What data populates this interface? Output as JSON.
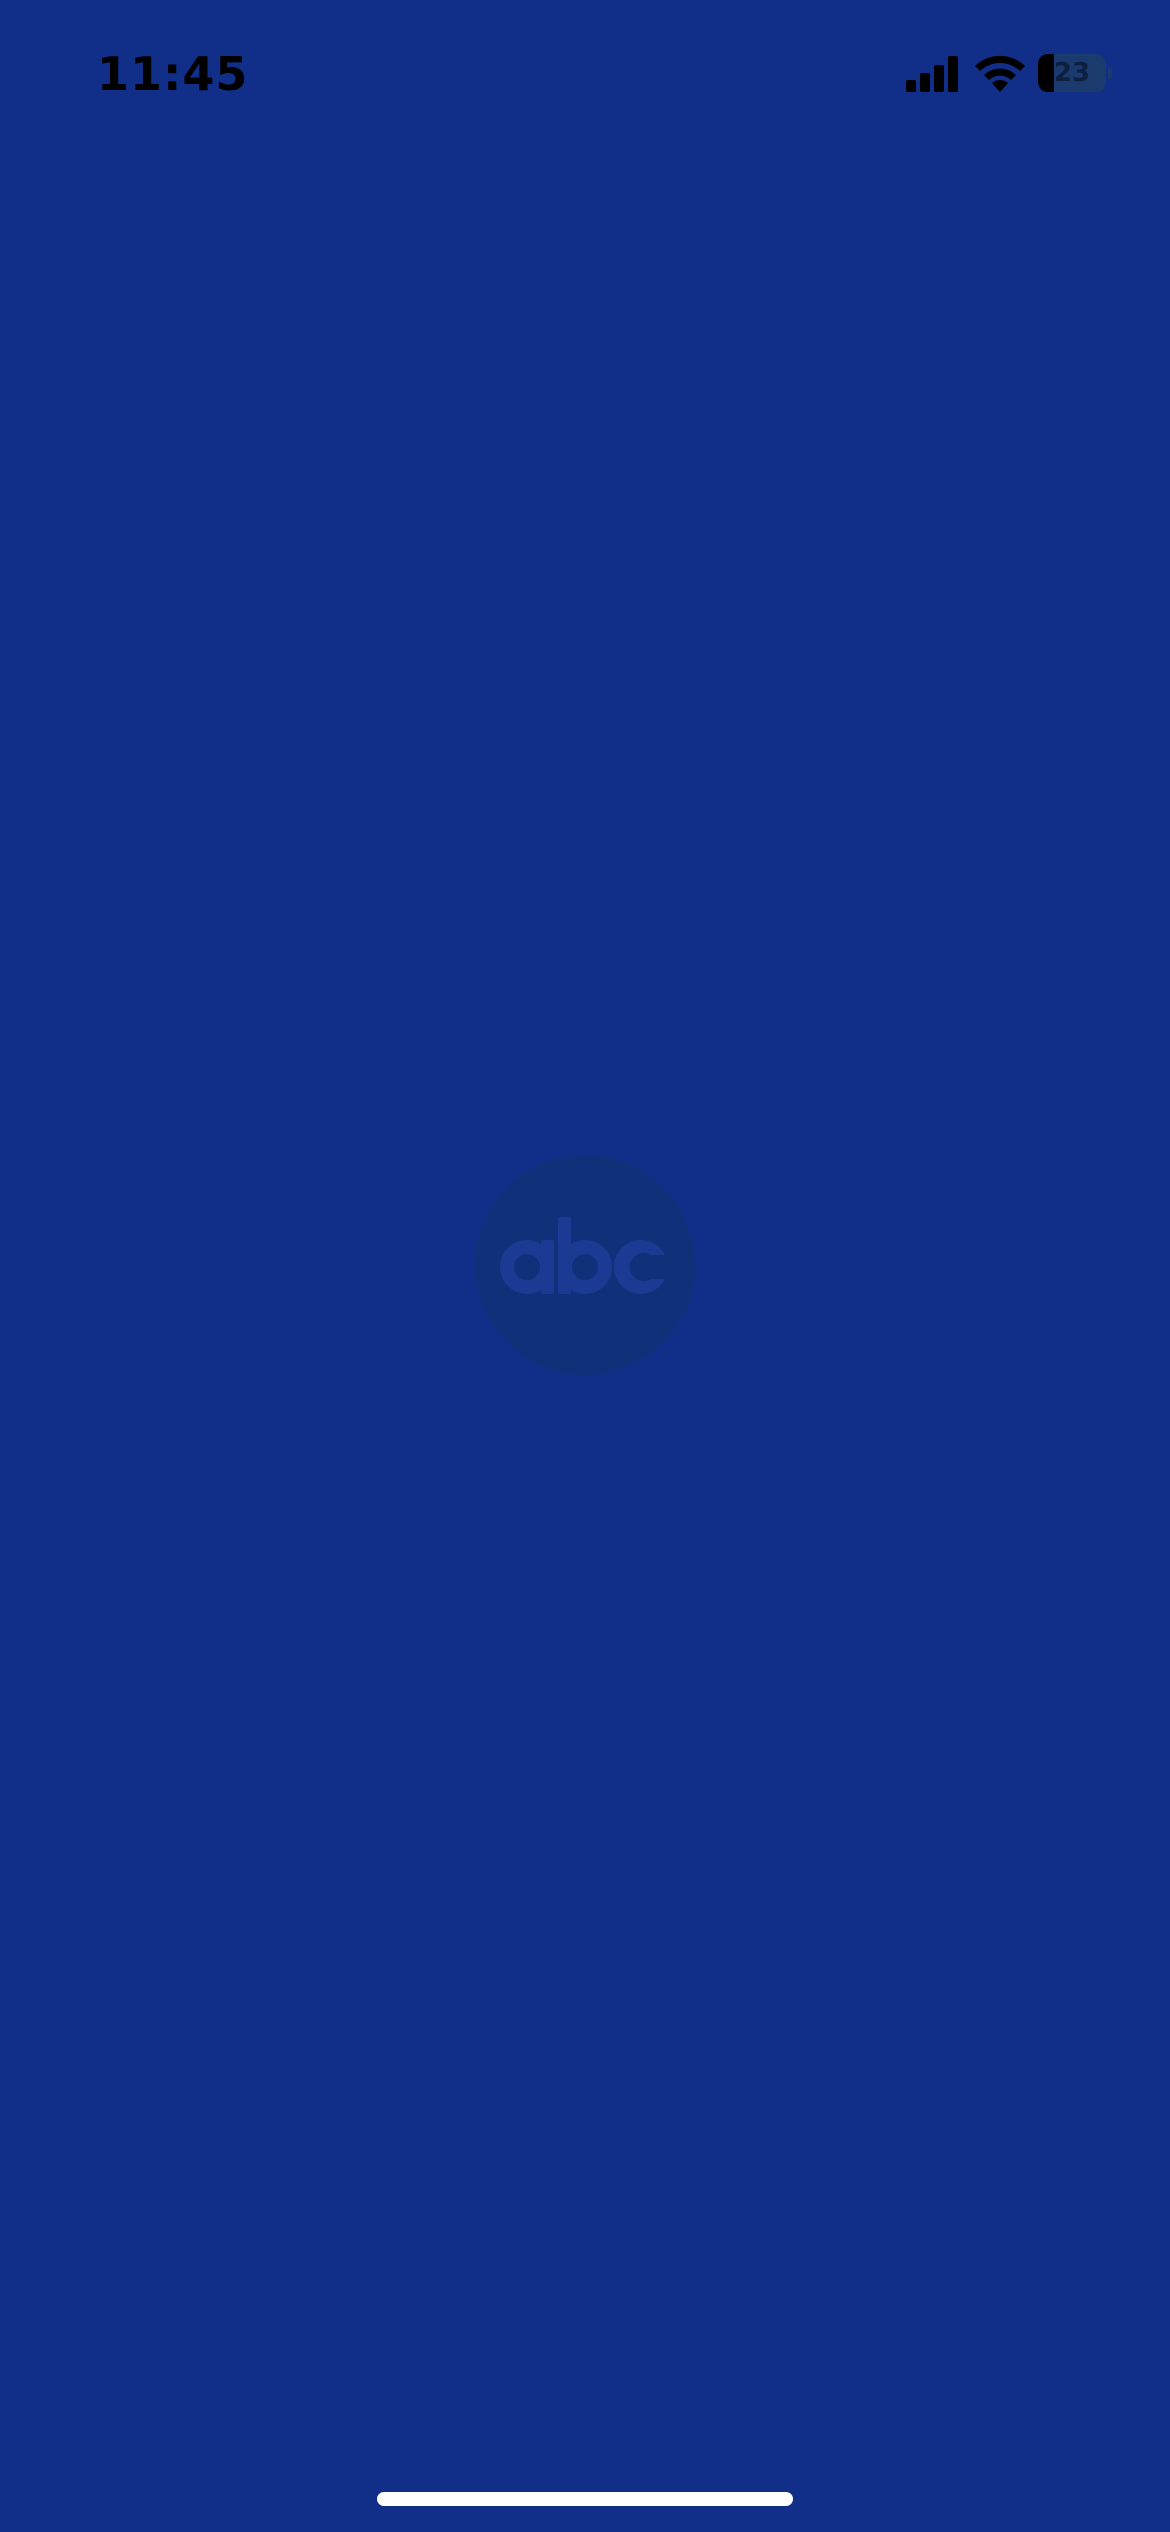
{
  "status_bar": {
    "time": "11:45",
    "battery_level": "23",
    "battery_fraction": 0.23,
    "icons": [
      "cellular-signal-icon",
      "wifi-icon",
      "battery-icon"
    ]
  },
  "splash": {
    "logo_text": "abc",
    "logo_icon": "abc-logo-icon"
  },
  "colors": {
    "background": "#112F88",
    "logo_circle": "#10307A",
    "logo_letters": "#1A3A93",
    "home_indicator": "#FFFFFF"
  }
}
